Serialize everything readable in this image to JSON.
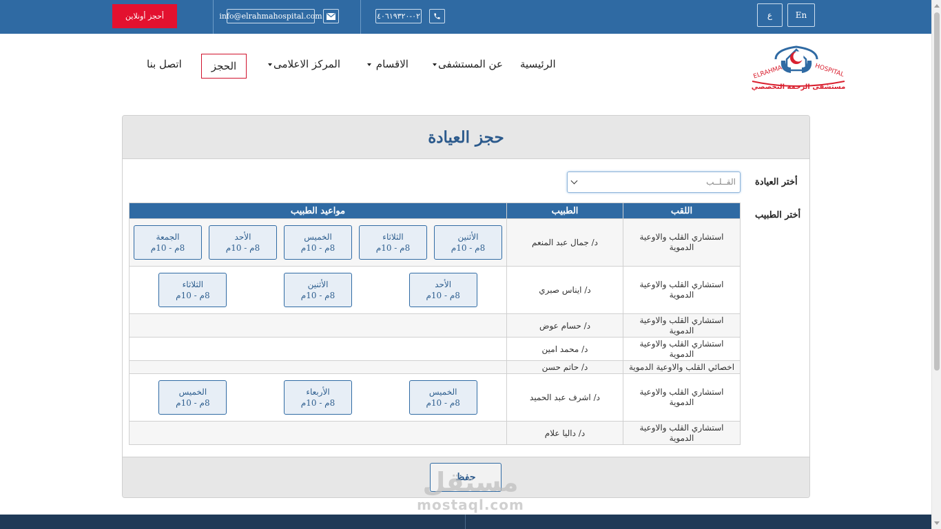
{
  "topbar": {
    "book_online": "أحجز أونلاين",
    "email": "info@elrahmahospital.com",
    "phone": "٠٢-٤٠٦١٩٣٢٠",
    "lang_ar": "ع",
    "lang_en": "En",
    "bg_color": "#2f6aa3",
    "book_color": "#e3112f"
  },
  "logo": {
    "name_en": "ELRAHMA HOSPITAL",
    "name_ar": "مستشفى الرحمة التخصصي"
  },
  "nav": {
    "home": "الرئيسية",
    "about": "عن المستشفى",
    "departments": "الاقسام",
    "media": "المركز الاعلامى",
    "booking": "الحجز",
    "contact": "اتصل بنا"
  },
  "panel": {
    "title": "حجز العيادة",
    "clinic_label": "أختر العيادة",
    "doctor_label": "أختر الطبيب",
    "clinic_selected": "القــلــب",
    "save": "حفظ"
  },
  "table": {
    "headers": {
      "title": "اللقب",
      "doctor": "الطبيب",
      "schedule": "مواعيد الطبيب"
    },
    "rows": [
      {
        "title": "استشاري القلب والاوعية الدموية",
        "doctor": "د/ جمال عبد المنعم",
        "slots": [
          {
            "day": "الأثنين",
            "time": "8م - 10م"
          },
          {
            "day": "الثلاثاء",
            "time": "8م - 10م"
          },
          {
            "day": "الخميس",
            "time": "8م - 10م"
          },
          {
            "day": "الأحد",
            "time": "8م - 10م"
          },
          {
            "day": "الجمعة",
            "time": "8م - 10م"
          }
        ]
      },
      {
        "title": "استشاري القلب والاوعية الدموية",
        "doctor": "د/ ايناس صبري",
        "slots": [
          {
            "day": "الأحد",
            "time": "8م - 10م"
          },
          {
            "day": "الأثنين",
            "time": "8م - 10م"
          },
          {
            "day": "الثلاثاء",
            "time": "8م - 10م"
          }
        ]
      },
      {
        "title": "استشاري القلب والاوعية الدموية",
        "doctor": "د/ حسام عوض",
        "slots": []
      },
      {
        "title": "استشاري القلب والاوعية الدموية",
        "doctor": "د/ محمد امين",
        "slots": []
      },
      {
        "title": "اخصائي القلب والاوعية الدموية",
        "doctor": "د/ حاتم حسن",
        "slots": []
      },
      {
        "title": "استشاري القلب والاوعية الدموية",
        "doctor": "د/ اشرف عبد الحميد",
        "slots": [
          {
            "day": "الخميس",
            "time": "8م - 10م"
          },
          {
            "day": "الأربعاء",
            "time": "8م - 10م"
          },
          {
            "day": "الخميس",
            "time": "8م - 10م"
          }
        ]
      },
      {
        "title": "استشاري القلب والاوعية الدموية",
        "doctor": "د/ داليا علام",
        "slots": []
      }
    ]
  },
  "watermark": {
    "ar": "مستقل",
    "en": "mostaql.com"
  }
}
